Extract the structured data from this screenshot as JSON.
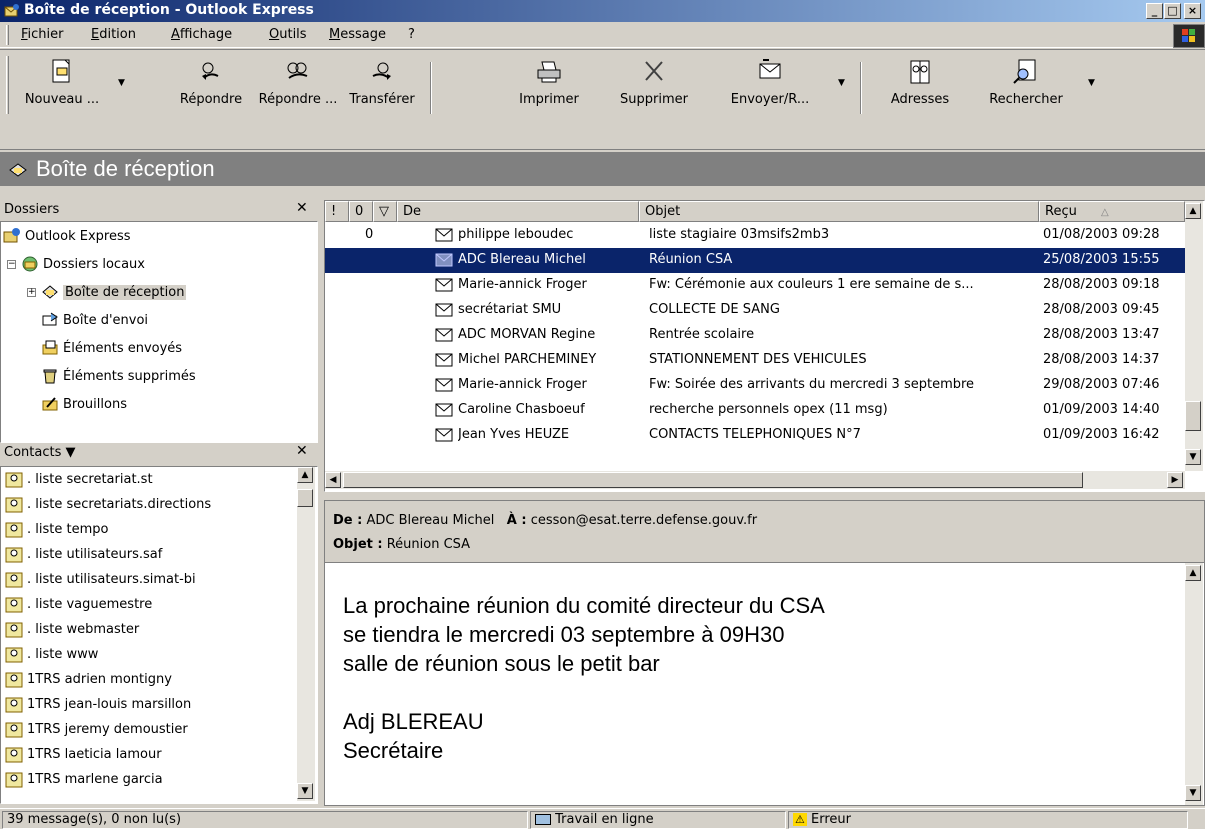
{
  "window": {
    "title": "Boîte de réception - Outlook Express",
    "buttons": {
      "minimize": "_",
      "maximize": "□",
      "close": "×"
    }
  },
  "menu": [
    "Fichier",
    "Edition",
    "Affichage",
    "Outils",
    "Message",
    "?"
  ],
  "toolbar": [
    {
      "label": "Nouveau ...",
      "icon": "new-mail-icon",
      "dropdown": true
    },
    {
      "label": "Répondre",
      "icon": "reply-icon"
    },
    {
      "label": "Répondre ...",
      "icon": "reply-all-icon"
    },
    {
      "label": "Transférer",
      "icon": "forward-icon"
    },
    {
      "label": "Imprimer",
      "icon": "print-icon"
    },
    {
      "label": "Supprimer",
      "icon": "delete-icon"
    },
    {
      "label": "Envoyer/R...",
      "icon": "send-receive-icon",
      "dropdown": true
    },
    {
      "label": "Adresses",
      "icon": "address-book-icon"
    },
    {
      "label": "Rechercher",
      "icon": "find-icon",
      "dropdown": true
    }
  ],
  "banner": {
    "title": "Boîte de réception"
  },
  "folders": {
    "header": "Dossiers",
    "items": [
      {
        "label": "Outlook Express",
        "icon": "outlook-icon"
      },
      {
        "label": "Dossiers locaux",
        "icon": "local-folders-icon"
      },
      {
        "label": "Boîte de réception",
        "icon": "inbox-icon",
        "selected": true
      },
      {
        "label": "Boîte d'envoi",
        "icon": "outbox-icon"
      },
      {
        "label": "Éléments envoyés",
        "icon": "sent-items-icon"
      },
      {
        "label": "Éléments supprimés",
        "icon": "deleted-items-icon"
      },
      {
        "label": "Brouillons",
        "icon": "drafts-icon"
      }
    ]
  },
  "contacts": {
    "header": "Contacts ▼",
    "items": [
      ". liste secretariat.st",
      ". liste secretariats.directions",
      ". liste tempo",
      ". liste utilisateurs.saf",
      ". liste utilisateurs.simat-bi",
      ". liste vaguemestre",
      ". liste webmaster",
      ". liste www",
      "1TRS adrien montigny",
      "1TRS jean-louis marsillon",
      "1TRS jeremy demoustier",
      "1TRS laeticia lamour",
      "1TRS marlene garcia"
    ]
  },
  "message_list": {
    "columns": [
      "!",
      "0",
      "▽",
      "De",
      "Objet",
      "Reçu"
    ],
    "sort_indicator": "△",
    "rows": [
      {
        "attach": "0",
        "from": "philippe leboudec",
        "subject": "liste stagiaire 03msifs2mb3",
        "received": "01/08/2003 09:28"
      },
      {
        "attach": "",
        "from": "ADC Blereau Michel",
        "subject": "Réunion CSA",
        "received": "25/08/2003 15:55",
        "selected": true
      },
      {
        "attach": "",
        "from": "Marie-annick Froger",
        "subject": "Fw: Cérémonie aux couleurs 1 ere  semaine de s...",
        "received": "28/08/2003 09:18"
      },
      {
        "attach": "",
        "from": "secrétariat SMU",
        "subject": "COLLECTE DE SANG",
        "received": "28/08/2003 09:45"
      },
      {
        "attach": "",
        "from": "ADC MORVAN Regine",
        "subject": "Rentrée scolaire",
        "received": "28/08/2003 13:47"
      },
      {
        "attach": "",
        "from": "Michel PARCHEMINEY",
        "subject": "STATIONNEMENT DES VEHICULES",
        "received": "28/08/2003 14:37"
      },
      {
        "attach": "",
        "from": "Marie-annick Froger",
        "subject": "Fw: Soirée des arrivants du mercredi 3 septembre",
        "received": "29/08/2003 07:46"
      },
      {
        "attach": "",
        "from": "Caroline Chasboeuf",
        "subject": "recherche personnels opex (11 msg)",
        "received": "01/09/2003 14:40"
      },
      {
        "attach": "",
        "from": "Jean Yves HEUZE",
        "subject": "CONTACTS TELEPHONIQUES N°7",
        "received": "01/09/2003 16:42"
      }
    ]
  },
  "preview": {
    "from_label": "De :",
    "from": "ADC Blereau Michel",
    "to_label": "À :",
    "to": "cesson@esat.terre.defense.gouv.fr",
    "subject_label": "Objet :",
    "subject": "Réunion CSA",
    "body": [
      "La prochaine réunion du comité directeur du CSA",
      "se tiendra le mercredi 03 septembre à 09H30",
      "salle de réunion sous le petit bar",
      "",
      "Adj BLEREAU",
      "Secrétaire"
    ]
  },
  "status": {
    "count": "39 message(s), 0 non lu(s)",
    "online": "Travail en ligne",
    "error": "Erreur"
  },
  "colors": {
    "selection": "#0a246a",
    "banner": "#808080",
    "chrome": "#d4d0c8"
  }
}
